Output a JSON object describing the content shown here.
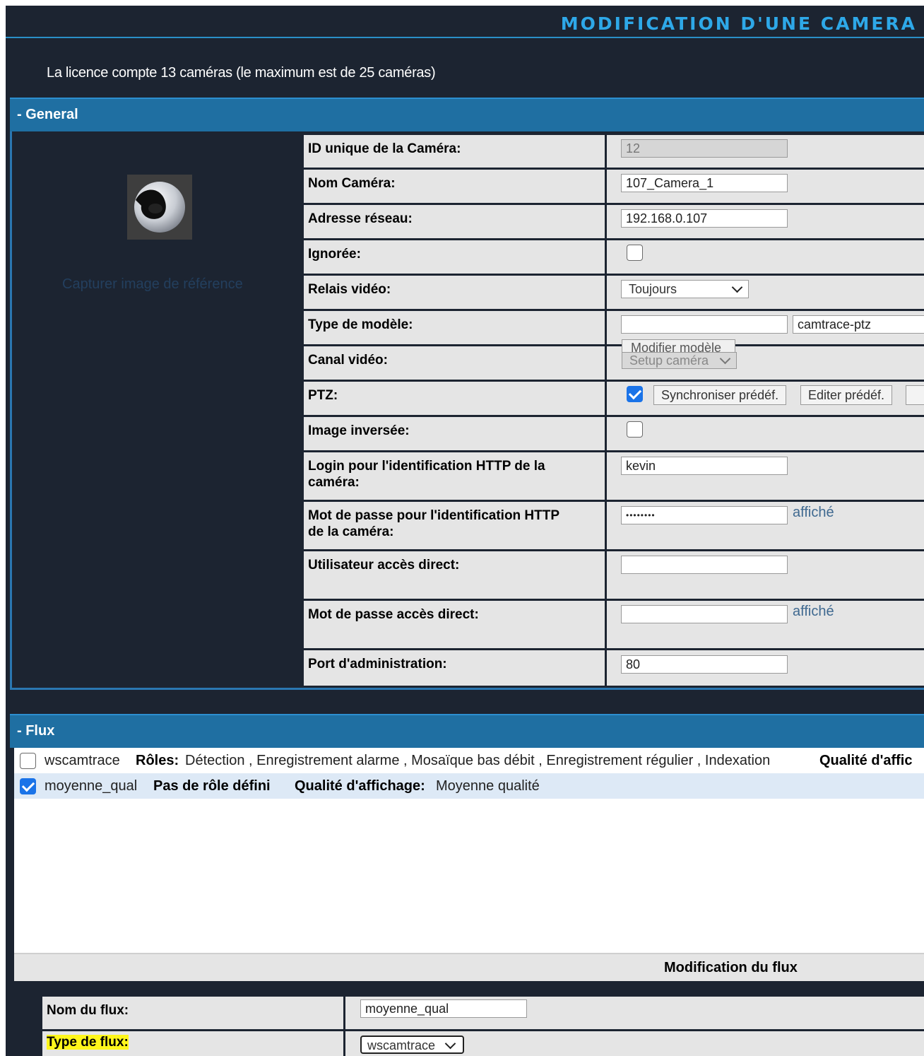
{
  "title": "MODIFICATION D'UNE CAMERA",
  "license_text": "La licence compte 13 caméras (le maximum est de 25 caméras)",
  "general": {
    "section_label": "- General",
    "capture_link": "Capturer image de référence",
    "fields": {
      "id": {
        "label": "ID unique de la Caméra:",
        "value": "12"
      },
      "name": {
        "label": "Nom Caméra:",
        "value": "107_Camera_1"
      },
      "address": {
        "label": "Adresse réseau:",
        "value": "192.168.0.107"
      },
      "ignored": {
        "label": "Ignorée:",
        "checked": false
      },
      "relay": {
        "label": "Relais vidéo:",
        "value": "Toujours"
      },
      "model": {
        "label": "Type de modèle:",
        "value": "",
        "model_name": "camtrace-ptz",
        "modify_button": "Modifier modèle"
      },
      "channel": {
        "label": "Canal vidéo:",
        "setup_button": "Setup caméra"
      },
      "ptz": {
        "label": "PTZ:",
        "checked": true,
        "sync_button": "Synchroniser prédéf.",
        "edit_button": "Editer prédéf."
      },
      "inverted": {
        "label": "Image inversée:",
        "checked": false
      },
      "http_login": {
        "label_line1": "Login pour l'identification HTTP de la",
        "label_line2": "caméra:",
        "value": "kevin"
      },
      "http_password": {
        "label_line1": "Mot de passe pour l'identification HTTP",
        "label_line2": "de la caméra:",
        "value": "••••••••",
        "show_label": "affiché"
      },
      "direct_user": {
        "label": "Utilisateur accès direct:",
        "value": ""
      },
      "direct_password": {
        "label": "Mot de passe accès direct:",
        "value": "",
        "show_label": "affiché"
      },
      "admin_port": {
        "label": "Port d'administration:",
        "value": "80"
      }
    }
  },
  "flux": {
    "section_label": "- Flux",
    "streams": [
      {
        "name": "wscamtrace",
        "checked": false,
        "roles_label": "Rôles:",
        "roles": "Détection , Enregistrement alarme , Mosaïque bas débit , Enregistrement régulier , Indexation",
        "quality_label": "Qualité d'affic"
      },
      {
        "name": "moyenne_qual",
        "checked": true,
        "roles_text": "Pas de rôle défini",
        "quality_label": "Qualité d'affichage:",
        "quality": "Moyenne qualité"
      }
    ],
    "modification_title": "Modification du flux",
    "stream_name": {
      "label": "Nom du flux:",
      "value": "moyenne_qual"
    },
    "stream_type": {
      "label": "Type de flux:",
      "value": "wscamtrace"
    }
  },
  "colors": {
    "title": "#2ea8e8",
    "section_header": "#1f6fa2",
    "background": "#1c2431",
    "highlight": "#fff61b",
    "checkbox_on": "#1a73e8"
  }
}
